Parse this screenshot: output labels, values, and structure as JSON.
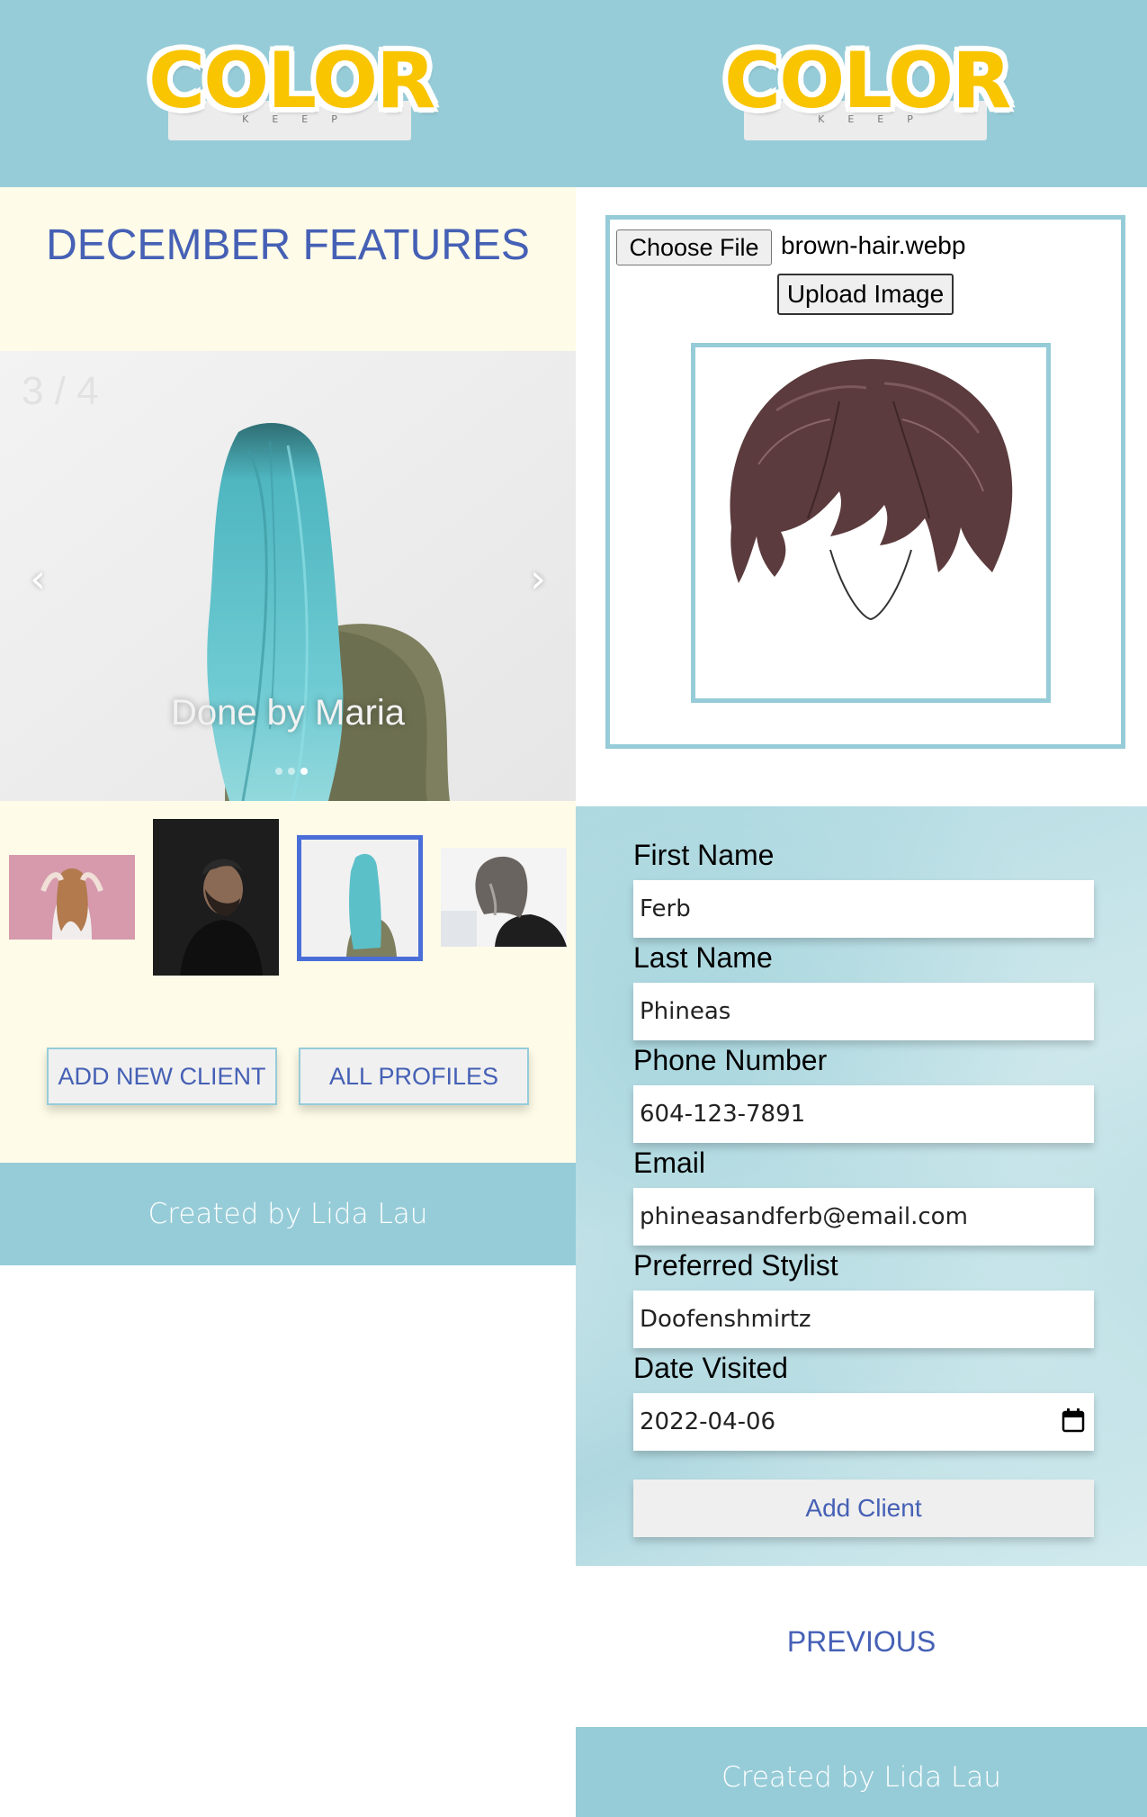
{
  "brand": {
    "logo_word": "COLOR",
    "logo_sub": "KEEP"
  },
  "home": {
    "features_title": "DECEMBER FEATURES",
    "carousel": {
      "counter": "3 / 4",
      "caption": "Done by Maria",
      "prev_icon": "chevron-left-icon",
      "next_icon": "chevron-right-icon",
      "slide_count": 3,
      "active_slide": 2
    },
    "thumbnails": [
      "woman-wavy-hair-pink-bg",
      "man-dark-portrait",
      "teal-hair-woman",
      "gray-bob-woman"
    ],
    "selected_thumbnail": 2,
    "buttons": {
      "add_new_client": "ADD NEW CLIENT",
      "all_profiles": "ALL PROFILES"
    },
    "footer": "Created by Lida Lau"
  },
  "add_client": {
    "upload": {
      "choose_file": "Choose File",
      "file_name": "brown-hair.webp",
      "upload_button": "Upload Image"
    },
    "form": {
      "first_name": {
        "label": "First Name",
        "value": "Ferb"
      },
      "last_name": {
        "label": "Last Name",
        "value": "Phineas"
      },
      "phone": {
        "label": "Phone Number",
        "value": "604-123-7891"
      },
      "email": {
        "label": "Email",
        "value": "phineasandferb@email.com"
      },
      "stylist": {
        "label": "Preferred Stylist",
        "value": "Doofenshmirtz"
      },
      "date": {
        "label": "Date Visited",
        "value": "2022-04-06",
        "icon": "calendar-icon"
      },
      "submit": "Add Client"
    },
    "previous": "PREVIOUS",
    "footer": "Created by Lida Lau"
  },
  "colors": {
    "header_bg": "#96ccd8",
    "cream_bg": "#fefce8",
    "accent_text": "#4560b5",
    "logo_yellow": "#f9c400",
    "thumb_selected_border": "#4a6ed8"
  }
}
